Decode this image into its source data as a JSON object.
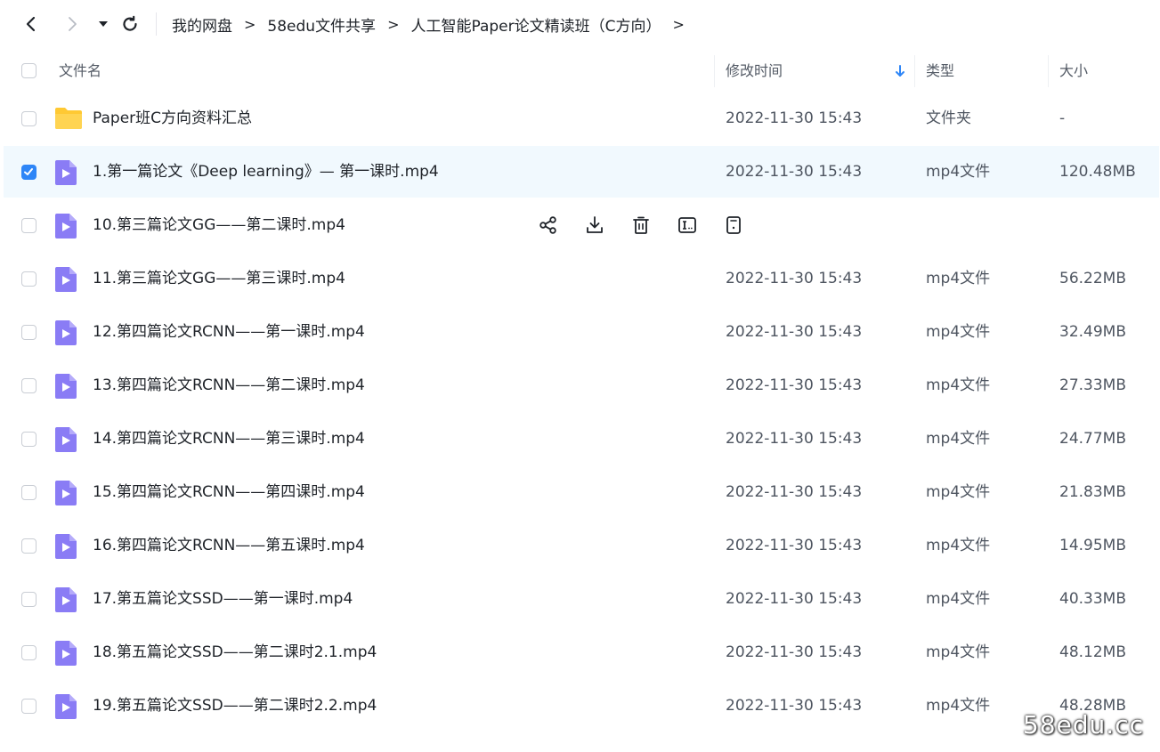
{
  "nav": {
    "back_icon": "chevron-left-icon",
    "forward_icon": "chevron-right-icon",
    "history_icon": "caret-down-icon",
    "refresh_icon": "refresh-icon"
  },
  "breadcrumb": {
    "items": [
      "我的网盘",
      "58edu文件共享",
      "人工智能Paper论文精读班（C方向）"
    ],
    "separator": ">"
  },
  "columns": {
    "name": "文件名",
    "modified": "修改时间",
    "type": "类型",
    "size": "大小",
    "sort_icon": "arrow-down-icon"
  },
  "colors": {
    "accent": "#2e86f7",
    "selected_row": "#f1f9fe",
    "folder": "#ffc933",
    "video_icon": "#8a7cf5"
  },
  "rows": [
    {
      "name": "Paper班C方向资料汇总",
      "time": "2022-11-30 15:43",
      "type": "文件夹",
      "size": "-",
      "icon": "folder-icon",
      "checked": false
    },
    {
      "name": "1.第一篇论文《Deep learning》— 第一课时.mp4",
      "time": "2022-11-30 15:43",
      "type": "mp4文件",
      "size": "120.48MB",
      "icon": "video-file-icon",
      "checked": true
    },
    {
      "name": "10.第三篇论文GG——第二课时.mp4",
      "time": "",
      "type": "",
      "size": "",
      "icon": "video-file-icon",
      "checked": false,
      "hovered": true
    },
    {
      "name": "11.第三篇论文GG——第三课时.mp4",
      "time": "2022-11-30 15:43",
      "type": "mp4文件",
      "size": "56.22MB",
      "icon": "video-file-icon",
      "checked": false
    },
    {
      "name": "12.第四篇论文RCNN——第一课时.mp4",
      "time": "2022-11-30 15:43",
      "type": "mp4文件",
      "size": "32.49MB",
      "icon": "video-file-icon",
      "checked": false
    },
    {
      "name": "13.第四篇论文RCNN——第二课时.mp4",
      "time": "2022-11-30 15:43",
      "type": "mp4文件",
      "size": "27.33MB",
      "icon": "video-file-icon",
      "checked": false
    },
    {
      "name": "14.第四篇论文RCNN——第三课时.mp4",
      "time": "2022-11-30 15:43",
      "type": "mp4文件",
      "size": "24.77MB",
      "icon": "video-file-icon",
      "checked": false
    },
    {
      "name": "15.第四篇论文RCNN——第四课时.mp4",
      "time": "2022-11-30 15:43",
      "type": "mp4文件",
      "size": "21.83MB",
      "icon": "video-file-icon",
      "checked": false
    },
    {
      "name": "16.第四篇论文RCNN——第五课时.mp4",
      "time": "2022-11-30 15:43",
      "type": "mp4文件",
      "size": "14.95MB",
      "icon": "video-file-icon",
      "checked": false
    },
    {
      "name": "17.第五篇论文SSD——第一课时.mp4",
      "time": "2022-11-30 15:43",
      "type": "mp4文件",
      "size": "40.33MB",
      "icon": "video-file-icon",
      "checked": false
    },
    {
      "name": "18.第五篇论文SSD——第二课时2.1.mp4",
      "time": "2022-11-30 15:43",
      "type": "mp4文件",
      "size": "48.12MB",
      "icon": "video-file-icon",
      "checked": false
    },
    {
      "name": "19.第五篇论文SSD——第二课时2.2.mp4",
      "time": "2022-11-30 15:43",
      "type": "mp4文件",
      "size": "48.28MB",
      "icon": "video-file-icon",
      "checked": false
    }
  ],
  "hover_actions": [
    "share-icon",
    "download-icon",
    "delete-icon",
    "rename-icon",
    "more-icon"
  ],
  "watermark": "58edu.cc"
}
